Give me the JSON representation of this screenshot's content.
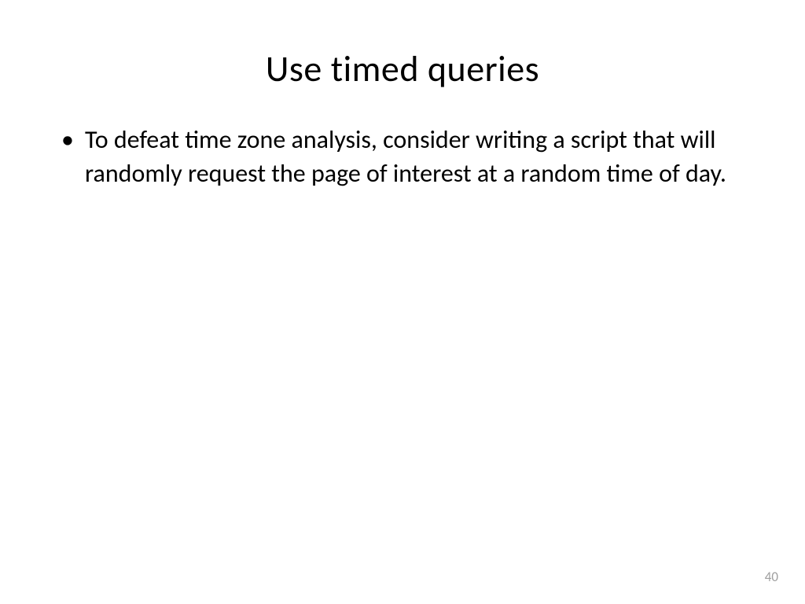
{
  "slide": {
    "title": "Use timed queries",
    "bullets": [
      "To defeat time zone analysis, consider writing a script that will randomly request the page of interest at a random time of day."
    ],
    "page_number": "40"
  }
}
